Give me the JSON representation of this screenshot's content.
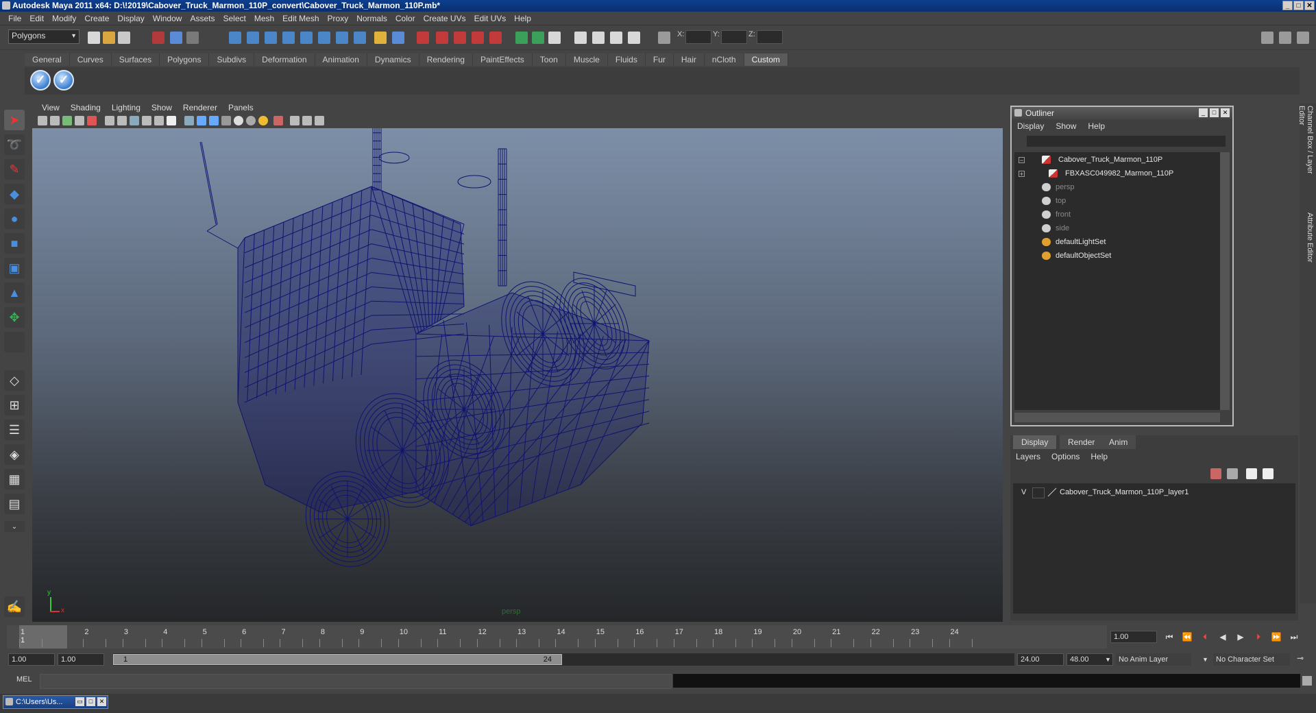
{
  "window": {
    "title": "Autodesk Maya 2011 x64: D:\\!2019\\Cabover_Truck_Marmon_110P_convert\\Cabover_Truck_Marmon_110P.mb*",
    "controls": [
      "minimize",
      "maximize",
      "close"
    ]
  },
  "menubar": [
    "File",
    "Edit",
    "Modify",
    "Create",
    "Display",
    "Window",
    "Assets",
    "Select",
    "Mesh",
    "Edit Mesh",
    "Proxy",
    "Normals",
    "Color",
    "Create UVs",
    "Edit UVs",
    "Help"
  ],
  "statusline": {
    "mode": "Polygons",
    "x_label": "X:",
    "y_label": "Y:",
    "z_label": "Z:"
  },
  "shelf": {
    "tabs": [
      "General",
      "Curves",
      "Surfaces",
      "Polygons",
      "Subdivs",
      "Deformation",
      "Animation",
      "Dynamics",
      "Rendering",
      "PaintEffects",
      "Toon",
      "Muscle",
      "Fluids",
      "Fur",
      "Hair",
      "nCloth",
      "Custom"
    ],
    "active_tab": "Custom",
    "buttons": [
      "check-icon",
      "check-icon"
    ]
  },
  "viewport": {
    "menus": [
      "View",
      "Shading",
      "Lighting",
      "Show",
      "Renderer",
      "Panels"
    ],
    "camera_label": "persp",
    "axis": {
      "x": "x",
      "y": "y"
    },
    "wire_color": "#101370"
  },
  "outliner": {
    "title": "Outliner",
    "menus": [
      "Display",
      "Show",
      "Help"
    ],
    "items": [
      {
        "label": "Cabover_Truck_Marmon_110P",
        "expand": "−",
        "icon": "mesh-group-icon",
        "dim": false
      },
      {
        "label": "FBXASC049982_Marmon_110P",
        "expand": "+",
        "icon": "mesh-group-icon",
        "dim": false
      },
      {
        "label": "persp",
        "icon": "camera-icon",
        "dim": true
      },
      {
        "label": "top",
        "icon": "camera-icon",
        "dim": true
      },
      {
        "label": "front",
        "icon": "camera-icon",
        "dim": true
      },
      {
        "label": "side",
        "icon": "camera-icon",
        "dim": true
      },
      {
        "label": "defaultLightSet",
        "icon": "set-icon",
        "dim": false
      },
      {
        "label": "defaultObjectSet",
        "icon": "set-icon",
        "dim": false
      }
    ]
  },
  "right_strip": {
    "tab1": "Channel Box / Layer Editor",
    "tab2": "Attribute Editor"
  },
  "layer_editor": {
    "tabs": [
      "Display",
      "Render",
      "Anim"
    ],
    "active_tab": "Display",
    "menus": [
      "Layers",
      "Options",
      "Help"
    ],
    "layers": [
      {
        "visible": "V",
        "name": "Cabover_Truck_Marmon_110P_layer1"
      }
    ]
  },
  "timeline": {
    "ticks": [
      "1",
      "2",
      "3",
      "4",
      "5",
      "6",
      "7",
      "8",
      "9",
      "10",
      "11",
      "12",
      "13",
      "14",
      "15",
      "16",
      "17",
      "18",
      "19",
      "20",
      "21",
      "22",
      "23",
      "24"
    ],
    "current_frame_marker": "1",
    "current_time": "1.00"
  },
  "range": {
    "start_time": "1.00",
    "playback_start": "1.00",
    "slider_start": "1",
    "slider_end": "24",
    "playback_end": "24.00",
    "end_time": "48.00",
    "anim_layer": "No Anim Layer",
    "character_set": "No Character Set"
  },
  "command_line": {
    "label": "MEL"
  },
  "taskbar": {
    "item": "C:\\Users\\Us..."
  }
}
